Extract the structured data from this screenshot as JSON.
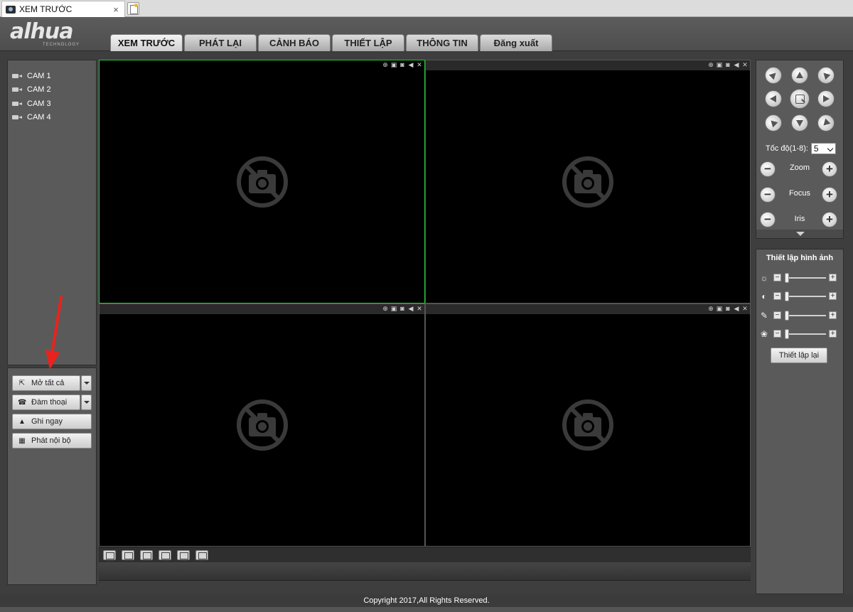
{
  "browser": {
    "tab_title": "XEM TRƯỚC",
    "tab_close": "×"
  },
  "header": {
    "logo_text": "alhua",
    "logo_sub": "TECHNOLOGY",
    "tabs": [
      {
        "label": "XEM TRƯỚC",
        "active": true
      },
      {
        "label": "PHÁT LẠI"
      },
      {
        "label": "CẢNH BÁO"
      },
      {
        "label": "THIẾT LẬP"
      },
      {
        "label": "THÔNG TIN"
      },
      {
        "label": "Đăng xuất"
      }
    ]
  },
  "cameras": [
    "CAM 1",
    "CAM 2",
    "CAM 3",
    "CAM 4"
  ],
  "actions": {
    "open_all": "Mở tất cả",
    "talk": "Đàm thoại",
    "record_now": "Ghi ngay",
    "local_play": "Phát nội bộ"
  },
  "video": {
    "active_border_color": "#29c43b",
    "cell_icons": [
      "zoom-icon",
      "snapshot-icon",
      "record-icon",
      "audio-icon",
      "close-icon"
    ]
  },
  "ptz": {
    "speed_label": "Tốc độ(1-8):",
    "speed_value": "5",
    "zoom_label": "Zoom",
    "focus_label": "Focus",
    "iris_label": "Iris",
    "minus": "−",
    "plus": "+"
  },
  "image_settings": {
    "title": "Thiết lập hình ảnh",
    "reset_label": "Thiết lập lại",
    "minus": "−",
    "plus": "+",
    "levels": {
      "brightness": 0.0,
      "contrast": 0.0,
      "saturation": 0.0,
      "hue": 0.0
    }
  },
  "footer": {
    "copyright": "Copyright 2017,All Rights Reserved."
  },
  "colors": {
    "annotation_arrow": "#e8231e"
  }
}
